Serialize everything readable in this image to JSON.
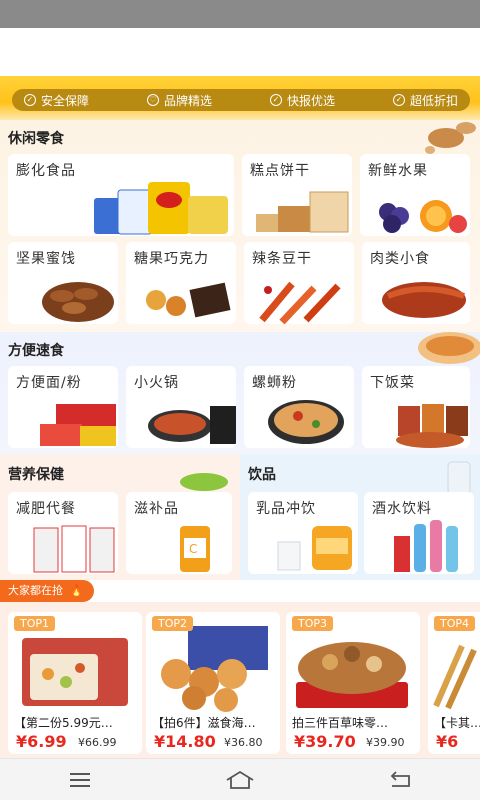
{
  "promo": {
    "items": [
      {
        "label": "安全保障",
        "icon": "shield-icon"
      },
      {
        "label": "品牌精选",
        "icon": "heart-icon"
      },
      {
        "label": "快报优选",
        "icon": "check-circle-icon"
      },
      {
        "label": "超低折扣",
        "icon": "check-circle-icon"
      }
    ]
  },
  "sections": {
    "snack": {
      "title": "休闲零食",
      "cards": [
        "膨化食品",
        "糕点饼干",
        "新鲜水果",
        "坚果蜜饯",
        "糖果巧克力",
        "辣条豆干",
        "肉类小食"
      ]
    },
    "fast": {
      "title": "方便速食",
      "cards": [
        "方便面/粉",
        "小火锅",
        "螺蛳粉",
        "下饭菜"
      ]
    },
    "health": {
      "title": "营养保健",
      "cards": [
        "减肥代餐",
        "滋补品"
      ]
    },
    "drink": {
      "title": "饮品",
      "cards": [
        "乳品冲饮",
        "酒水饮料"
      ]
    }
  },
  "hot": {
    "tag": "大家都在抢",
    "products": [
      {
        "rank": "TOP1",
        "name": "【第二份5.99元…",
        "price": "¥6.99",
        "old_price": "¥66.99"
      },
      {
        "rank": "TOP2",
        "name": "【拍6件】滋食海…",
        "price": "¥14.80",
        "old_price": "¥36.80"
      },
      {
        "rank": "TOP3",
        "name": "拍三件百草味零…",
        "price": "¥39.70",
        "old_price": "¥39.90"
      },
      {
        "rank": "TOP4",
        "name": "【卡其…",
        "price": "¥6",
        "old_price": ""
      }
    ]
  },
  "colors": {
    "accent": "#f46a1d",
    "price": "#e8281f",
    "rank_badge": "#f7a84d",
    "banner": "#ffc21a"
  }
}
